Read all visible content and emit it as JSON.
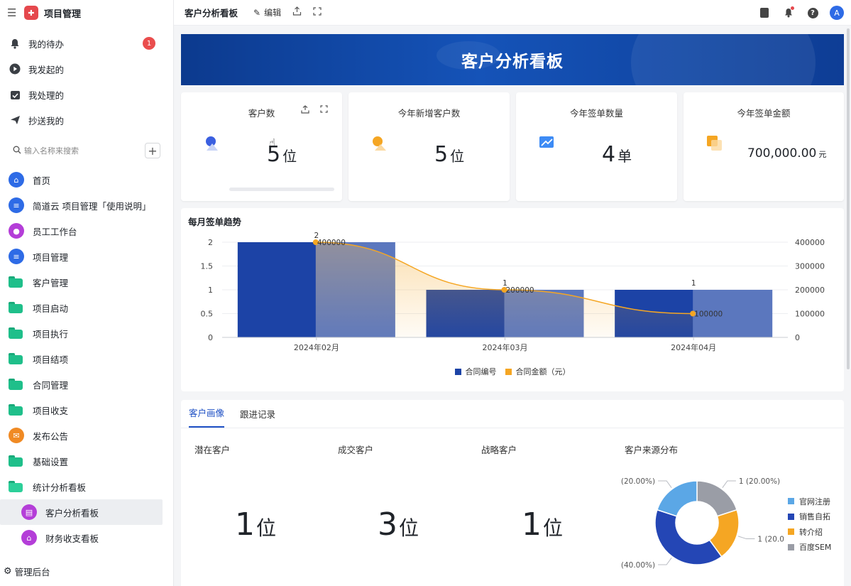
{
  "app": {
    "title": "项目管理"
  },
  "quick_menu": [
    {
      "label": "我的待办",
      "icon": "bell-icon",
      "badge": "1"
    },
    {
      "label": "我发起的",
      "icon": "play-circle-icon"
    },
    {
      "label": "我处理的",
      "icon": "calendar-check-icon"
    },
    {
      "label": "抄送我的",
      "icon": "send-icon"
    }
  ],
  "search": {
    "placeholder": "输入名称来搜索"
  },
  "nav": [
    {
      "label": "首页",
      "icon": "home-icon",
      "kind": "circle",
      "color": "#2e6be6"
    },
    {
      "label": "简道云 项目管理「使用说明」",
      "icon": "document-icon",
      "kind": "circle",
      "color": "#2e6be6"
    },
    {
      "label": "员工工作台",
      "icon": "user-group-icon",
      "kind": "circle",
      "color": "#b43ed8"
    },
    {
      "label": "项目管理",
      "icon": "document-icon",
      "kind": "circle",
      "color": "#2e6be6"
    },
    {
      "label": "客户管理",
      "icon": "folder-icon",
      "kind": "folder"
    },
    {
      "label": "项目启动",
      "icon": "folder-icon",
      "kind": "folder"
    },
    {
      "label": "项目执行",
      "icon": "folder-icon",
      "kind": "folder"
    },
    {
      "label": "项目结项",
      "icon": "folder-icon",
      "kind": "folder"
    },
    {
      "label": "合同管理",
      "icon": "folder-icon",
      "kind": "folder"
    },
    {
      "label": "项目收支",
      "icon": "folder-icon",
      "kind": "folder"
    },
    {
      "label": "发布公告",
      "icon": "announce-icon",
      "kind": "circle",
      "color": "#f08a24"
    },
    {
      "label": "基础设置",
      "icon": "folder-icon",
      "kind": "folder"
    },
    {
      "label": "统计分析看板",
      "icon": "folder-open-icon",
      "kind": "folder-open"
    },
    {
      "label": "客户分析看板",
      "icon": "dashboard-icon",
      "kind": "sub",
      "color": "#b43ed8",
      "active": true
    },
    {
      "label": "财务收支看板",
      "icon": "finance-icon",
      "kind": "sub",
      "color": "#b43ed8"
    }
  ],
  "footer": {
    "label": "管理后台"
  },
  "topbar": {
    "title": "客户分析看板",
    "edit_label": "编辑"
  },
  "banner": {
    "title": "客户分析看板"
  },
  "stats": [
    {
      "label": "客户数",
      "value": "5",
      "unit": "位",
      "color": "#3a5fe0"
    },
    {
      "label": "今年新增客户数",
      "value": "5",
      "unit": "位",
      "color": "#f5a623"
    },
    {
      "label": "今年签单数量",
      "value": "4",
      "unit": "单",
      "color": "#3d8bf5"
    },
    {
      "label": "今年签单金额",
      "value": "700,000.00",
      "unit": "元",
      "color": "#f5a623"
    }
  ],
  "chart_data": {
    "type": "bar",
    "title": "每月签单趋势",
    "categories": [
      "2024年02月",
      "2024年03月",
      "2024年04月"
    ],
    "series": [
      {
        "name": "合同编号",
        "type": "bar",
        "axis": "left",
        "values": [
          2,
          1,
          1
        ],
        "color": "#1c43a6"
      },
      {
        "name": "合同金额（元）",
        "type": "area",
        "axis": "right",
        "values": [
          400000,
          200000,
          100000
        ],
        "color": "#f5a623"
      }
    ],
    "left_ticks": [
      "0",
      "0.5",
      "1",
      "1.5",
      "2"
    ],
    "right_ticks": [
      "0",
      "100000",
      "200000",
      "300000",
      "400000"
    ],
    "left_ylim": [
      0,
      2
    ],
    "right_ylim": [
      0,
      400000
    ],
    "bar_labels": [
      "2",
      "1",
      "1"
    ],
    "line_labels": [
      "400000",
      "200000",
      "100000"
    ],
    "legend": "bottom-center"
  },
  "tabs": [
    {
      "label": "客户画像",
      "active": true
    },
    {
      "label": "跟进记录",
      "active": false
    }
  ],
  "kpis": [
    {
      "label": "潜在客户",
      "value": "1",
      "unit": "位"
    },
    {
      "label": "成交客户",
      "value": "3",
      "unit": "位"
    },
    {
      "label": "战略客户",
      "value": "1",
      "unit": "位"
    }
  ],
  "pie": {
    "title": "客户来源分布",
    "chart_data": {
      "type": "pie",
      "donut": true,
      "slices": [
        {
          "name": "官网注册",
          "value": 1,
          "label": "1 (20.00%)",
          "color": "#5ba7e6"
        },
        {
          "name": "销售自拓",
          "value": 2,
          "label": "(40.00%)",
          "color": "#2446b5"
        },
        {
          "name": "转介绍",
          "value": 1,
          "label": "1 (20.0",
          "color": "#f5a623"
        },
        {
          "name": "百度SEM",
          "value": 1,
          "label": "1 (20.00%)",
          "color": "#9a9da6"
        }
      ],
      "left_label": "(20.00%)"
    }
  }
}
